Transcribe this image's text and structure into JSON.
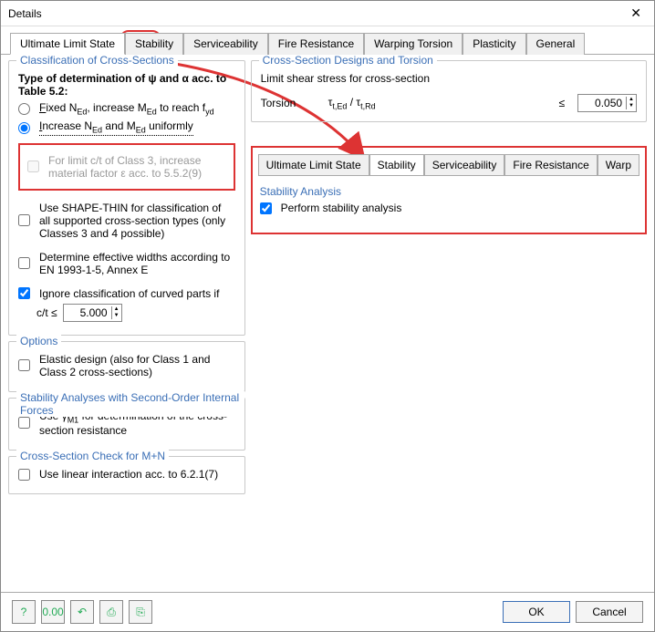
{
  "window": {
    "title": "Details"
  },
  "tabs": {
    "items": [
      {
        "label": "Ultimate Limit State"
      },
      {
        "label": "Stability"
      },
      {
        "label": "Serviceability"
      },
      {
        "label": "Fire Resistance"
      },
      {
        "label": "Warping Torsion"
      },
      {
        "label": "Plasticity"
      },
      {
        "label": "General"
      }
    ],
    "active": 0
  },
  "left": {
    "classification": {
      "title": "Classification of Cross-Sections",
      "type_label": "Type of determination of ψ and α acc. to Table 5.2:",
      "radio_fixed_pre": "F",
      "radio_fixed_rest": "ixed N",
      "radio_fixed_tail": ", increase M",
      "radio_fixed_tail2": " to reach f",
      "sub_ed": "Ed",
      "sub_yd": "yd",
      "radio_increase_pre": "I",
      "radio_increase_rest": "ncrease N",
      "radio_increase_mid": " and M",
      "radio_increase_tail": " uniformly",
      "limit_ct": "For limit c/t of Class 3, increase material factor ε acc. to 5.5.2(9)",
      "shape_thin": "Use SHAPE-THIN for classification of all supported cross-section types (only Classes 3 and 4 possible)",
      "eff_widths": "Determine effective widths according to EN 1993-1-5, Annex E",
      "ignore_curved": "Ignore classification of curved parts if",
      "ct_label": "c/t ≤",
      "ct_value": "5.000"
    },
    "options": {
      "title": "Options",
      "elastic": "Elastic design (also for Class 1 and Class 2 cross-sections)"
    },
    "stability2": {
      "title": "Stability Analyses with Second-Order Internal Forces",
      "gamma_pre": "Use γ",
      "gamma_sub": "M1",
      "gamma_tail": " for determination of the cross-section resistance"
    },
    "mn": {
      "title": "Cross-Section Check for M+N",
      "linear": "Use linear interaction acc. to 6.2.1(7)"
    }
  },
  "right": {
    "cs_designs": {
      "title": "Cross-Section Designs and Torsion",
      "shear_label": "Limit shear stress for cross-section",
      "torsion_label": "Torsion",
      "formula_pre": "τ",
      "formula_sub1": "t,Ed",
      "formula_mid": " / τ",
      "formula_sub2": "t,Rd",
      "leq": "≤",
      "torsion_value": "0.050"
    },
    "inner_tabs": {
      "items": [
        {
          "label": "Ultimate Limit State"
        },
        {
          "label": "Stability"
        },
        {
          "label": "Serviceability"
        },
        {
          "label": "Fire Resistance"
        },
        {
          "label": "Warp"
        }
      ],
      "active": 1
    },
    "stability": {
      "title": "Stability Analysis",
      "perform": "Perform stability analysis"
    }
  },
  "footer": {
    "ok": "OK",
    "cancel": "Cancel",
    "icons": [
      "?",
      "0.00",
      "↶",
      "⎙",
      "⎘"
    ]
  }
}
